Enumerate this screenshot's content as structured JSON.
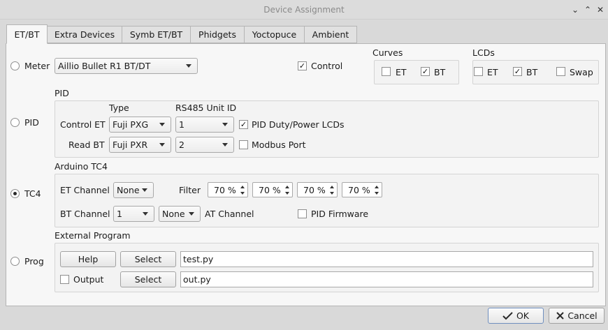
{
  "window": {
    "title": "Device Assignment",
    "minimize_glyph": "⌄",
    "maximize_glyph": "⌃",
    "close_glyph": "✕"
  },
  "tabs": [
    {
      "label": "ET/BT",
      "active": true
    },
    {
      "label": "Extra Devices"
    },
    {
      "label": "Symb ET/BT"
    },
    {
      "label": "Phidgets"
    },
    {
      "label": "Yoctopuce"
    },
    {
      "label": "Ambient"
    }
  ],
  "meter": {
    "radio_label": "Meter",
    "selected": false,
    "device": "Aillio Bullet R1 BT/DT",
    "control_label": "Control",
    "control_checked": true
  },
  "curves": {
    "title": "Curves",
    "et_label": "ET",
    "et_checked": false,
    "bt_label": "BT",
    "bt_checked": true
  },
  "lcds": {
    "title": "LCDs",
    "et_label": "ET",
    "et_checked": false,
    "bt_label": "BT",
    "bt_checked": true,
    "swap_label": "Swap",
    "swap_checked": false
  },
  "pid": {
    "radio_label": "PID",
    "selected": false,
    "group_title": "PID",
    "type_header": "Type",
    "unit_header": "RS485 Unit ID",
    "control_et_label": "Control ET",
    "control_et_type": "Fuji PXG",
    "control_et_unit": "1",
    "read_bt_label": "Read BT",
    "read_bt_type": "Fuji PXR",
    "read_bt_unit": "2",
    "duty_lcds_label": "PID Duty/Power LCDs",
    "duty_lcds_checked": true,
    "modbus_label": "Modbus Port",
    "modbus_checked": false
  },
  "tc4": {
    "radio_label": "TC4",
    "selected": true,
    "group_title": "Arduino TC4",
    "et_channel_label": "ET Channel",
    "et_channel_value": "None",
    "filter_label": "Filter",
    "filters": [
      "70 %",
      "70 %",
      "70 %",
      "70 %"
    ],
    "bt_channel_label": "BT Channel",
    "bt_channel_value": "1",
    "at_channel_value": "None",
    "at_channel_label": "AT Channel",
    "pid_firmware_label": "PID Firmware",
    "pid_firmware_checked": false
  },
  "prog": {
    "radio_label": "Prog",
    "selected": false,
    "group_title": "External Program",
    "help_label": "Help",
    "select_label": "Select",
    "program_path": "test.py",
    "output_label": "Output",
    "output_checked": false,
    "output_select_label": "Select",
    "output_path": "out.py"
  },
  "footer": {
    "ok_label": "OK",
    "cancel_label": "Cancel"
  },
  "check_glyph": "✓"
}
